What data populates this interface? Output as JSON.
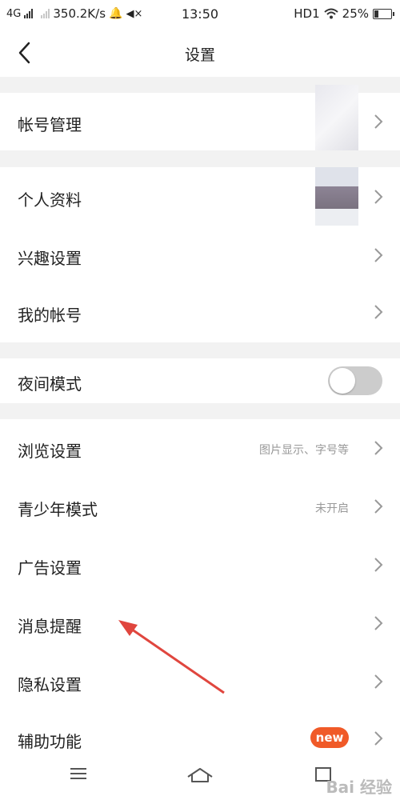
{
  "status_bar": {
    "network": "4G",
    "speed": "350.2K/s",
    "time": "13:50",
    "hd": "HD1",
    "battery": "25%"
  },
  "nav": {
    "title": "设置"
  },
  "rows": {
    "account_mgmt": "帐号管理",
    "profile": "个人资料",
    "interest": "兴趣设置",
    "my_account": "我的帐号",
    "night_mode": "夜间模式",
    "browse": "浏览设置",
    "browse_value": "图片显示、字号等",
    "teen": "青少年模式",
    "teen_value": "未开启",
    "ads": "广告设置",
    "notify": "消息提醒",
    "privacy": "隐私设置",
    "accessibility": "辅助功能",
    "accessibility_badge": "new"
  },
  "toggles": {
    "night_mode_on": false
  },
  "watermark": "Bai 经验",
  "colors": {
    "accent_badge": "#f05a28",
    "annotation_arrow": "#e0463e"
  }
}
